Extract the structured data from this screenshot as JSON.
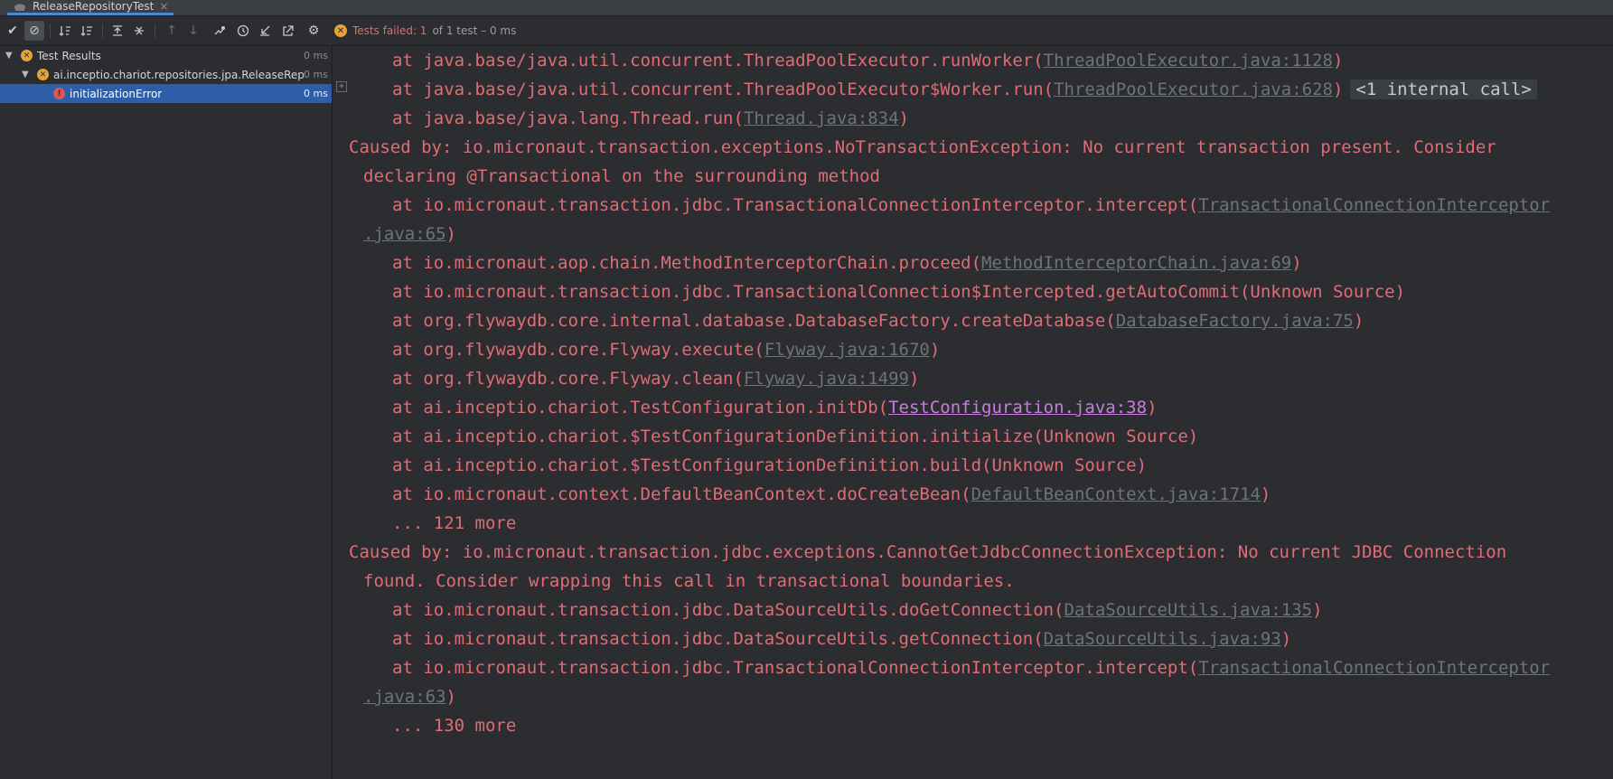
{
  "tab": {
    "title": "ReleaseRepositoryTest",
    "close": "×"
  },
  "toolbar": {
    "status": {
      "failed": "Tests failed: 1",
      "count": "of 1 test – 0 ms"
    }
  },
  "tree": {
    "rows": [
      {
        "label": "Test Results",
        "time": "0 ms"
      },
      {
        "label": "ai.inceptio.chariot.repositories.jpa.ReleaseReposi",
        "time": "0 ms"
      },
      {
        "label": "initializationError",
        "time": "0 ms"
      }
    ]
  },
  "console": {
    "l1": {
      "pre": "at java.base/java.util.concurrent.ThreadPoolExecutor.runWorker(",
      "link": "ThreadPoolExecutor.java:1128",
      "post": ")"
    },
    "l2": {
      "pre": "at java.base/java.util.concurrent.ThreadPoolExecutor$Worker.run(",
      "link": "ThreadPoolExecutor.java:628",
      "post": ")",
      "internal": "<1 internal call>"
    },
    "l3": {
      "pre": "at java.base/java.lang.Thread.run(",
      "link": "Thread.java:834",
      "post": ")"
    },
    "l4": "Caused by: io.micronaut.transaction.exceptions.NoTransactionException: No current transaction present. Consider",
    "l5": "declaring @Transactional on the surrounding method",
    "l6": {
      "pre": "at io.micronaut.transaction.jdbc.TransactionalConnectionInterceptor.intercept(",
      "link": "TransactionalConnectionInterceptor"
    },
    "l7": {
      "link": ".java:65",
      "post": ")"
    },
    "l8": {
      "pre": "at io.micronaut.aop.chain.MethodInterceptorChain.proceed(",
      "link": "MethodInterceptorChain.java:69",
      "post": ")"
    },
    "l9": "at io.micronaut.transaction.jdbc.TransactionalConnection$Intercepted.getAutoCommit(Unknown Source)",
    "l10": {
      "pre": "at org.flywaydb.core.internal.database.DatabaseFactory.createDatabase(",
      "link": "DatabaseFactory.java:75",
      "post": ")"
    },
    "l11": {
      "pre": "at org.flywaydb.core.Flyway.execute(",
      "link": "Flyway.java:1670",
      "post": ")"
    },
    "l12": {
      "pre": "at org.flywaydb.core.Flyway.clean(",
      "link": "Flyway.java:1499",
      "post": ")"
    },
    "l13": {
      "pre": "at ai.inceptio.chariot.TestConfiguration.initDb(",
      "link": "TestConfiguration.java:38",
      "post": ")"
    },
    "l14": "at ai.inceptio.chariot.$TestConfigurationDefinition.initialize(Unknown Source)",
    "l15": "at ai.inceptio.chariot.$TestConfigurationDefinition.build(Unknown Source)",
    "l16": {
      "pre": "at io.micronaut.context.DefaultBeanContext.doCreateBean(",
      "link": "DefaultBeanContext.java:1714",
      "post": ")"
    },
    "l17": "... 121 more",
    "l18": "Caused by: io.micronaut.transaction.jdbc.exceptions.CannotGetJdbcConnectionException: No current JDBC Connection",
    "l19": "found. Consider wrapping this call in transactional boundaries.",
    "l20": {
      "pre": "at io.micronaut.transaction.jdbc.DataSourceUtils.doGetConnection(",
      "link": "DataSourceUtils.java:135",
      "post": ")"
    },
    "l21": {
      "pre": "at io.micronaut.transaction.jdbc.DataSourceUtils.getConnection(",
      "link": "DataSourceUtils.java:93",
      "post": ")"
    },
    "l22": {
      "pre": "at io.micronaut.transaction.jdbc.TransactionalConnectionInterceptor.intercept(",
      "link": "TransactionalConnectionInterceptor"
    },
    "l23": {
      "link": ".java:63",
      "post": ")"
    },
    "l24": "... 130 more"
  }
}
